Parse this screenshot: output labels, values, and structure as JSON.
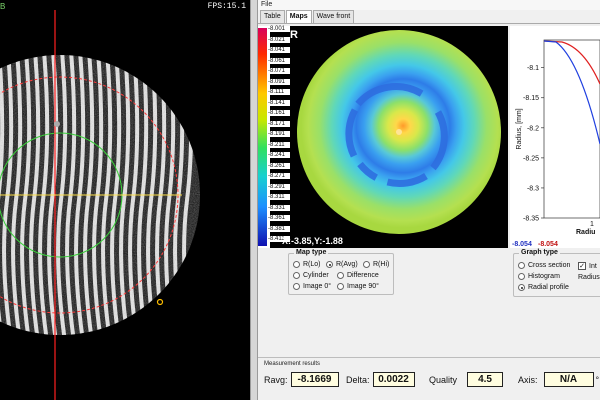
{
  "camera": {
    "fps_text": "FPS:15.1",
    "corner_mark": "B"
  },
  "menu": {
    "file": "File"
  },
  "tabs": [
    "Table",
    "Maps",
    "Wave front"
  ],
  "map": {
    "channel": "R",
    "coordinate_readout": "X:-3.85,Y:-1.88",
    "legend_ticks": [
      "-8.001",
      "-8.021",
      "-8.041",
      "-8.061",
      "-8.071",
      "-8.091",
      "-8.111",
      "-8.141",
      "-8.161",
      "-8.171",
      "-8.191",
      "-8.211",
      "-8.241",
      "-8.261",
      "-8.271",
      "-8.291",
      "-8.311",
      "-8.331",
      "-8.361",
      "-8.381",
      "-8.411"
    ]
  },
  "chart_data": {
    "type": "line",
    "ylabel": "Radius, [mm]",
    "xlabel": "Radiu",
    "yticks": [
      "-8.1",
      "-8.15",
      "-8.2",
      "-8.25",
      "-8.3",
      "-8.35"
    ],
    "xticks": [
      "1"
    ],
    "ylim": [
      -8.35,
      -8.054
    ],
    "x_bottom_labels": {
      "left": "-8.054",
      "right": "-8.054"
    },
    "series": [
      {
        "color": "#e02020"
      },
      {
        "color": "#2040e0"
      }
    ]
  },
  "map_type": {
    "title": "Map type",
    "options": [
      "R(Lo)",
      "R(Avg)",
      "R(Hi)",
      "Cylinder",
      "Difference",
      "Image 0°",
      "Image 90°"
    ],
    "selected": "R(Avg)"
  },
  "graph_type": {
    "title": "Graph type",
    "options": [
      "Cross section",
      "Histogram",
      "Radial profile"
    ],
    "selected": "Radial profile",
    "checkbox_label": "Int",
    "checkbox_checked": true,
    "radius_label": "Radius"
  },
  "results": {
    "title": "Measurement results",
    "ravg_label": "Ravg:",
    "ravg_value": "-8.1669",
    "delta_label": "Delta:",
    "delta_value": "0.0022",
    "quality_label": "Quality",
    "quality_value": "4.5",
    "axis_label": "Axis:",
    "axis_value": "N/A",
    "axis_unit": "°"
  }
}
